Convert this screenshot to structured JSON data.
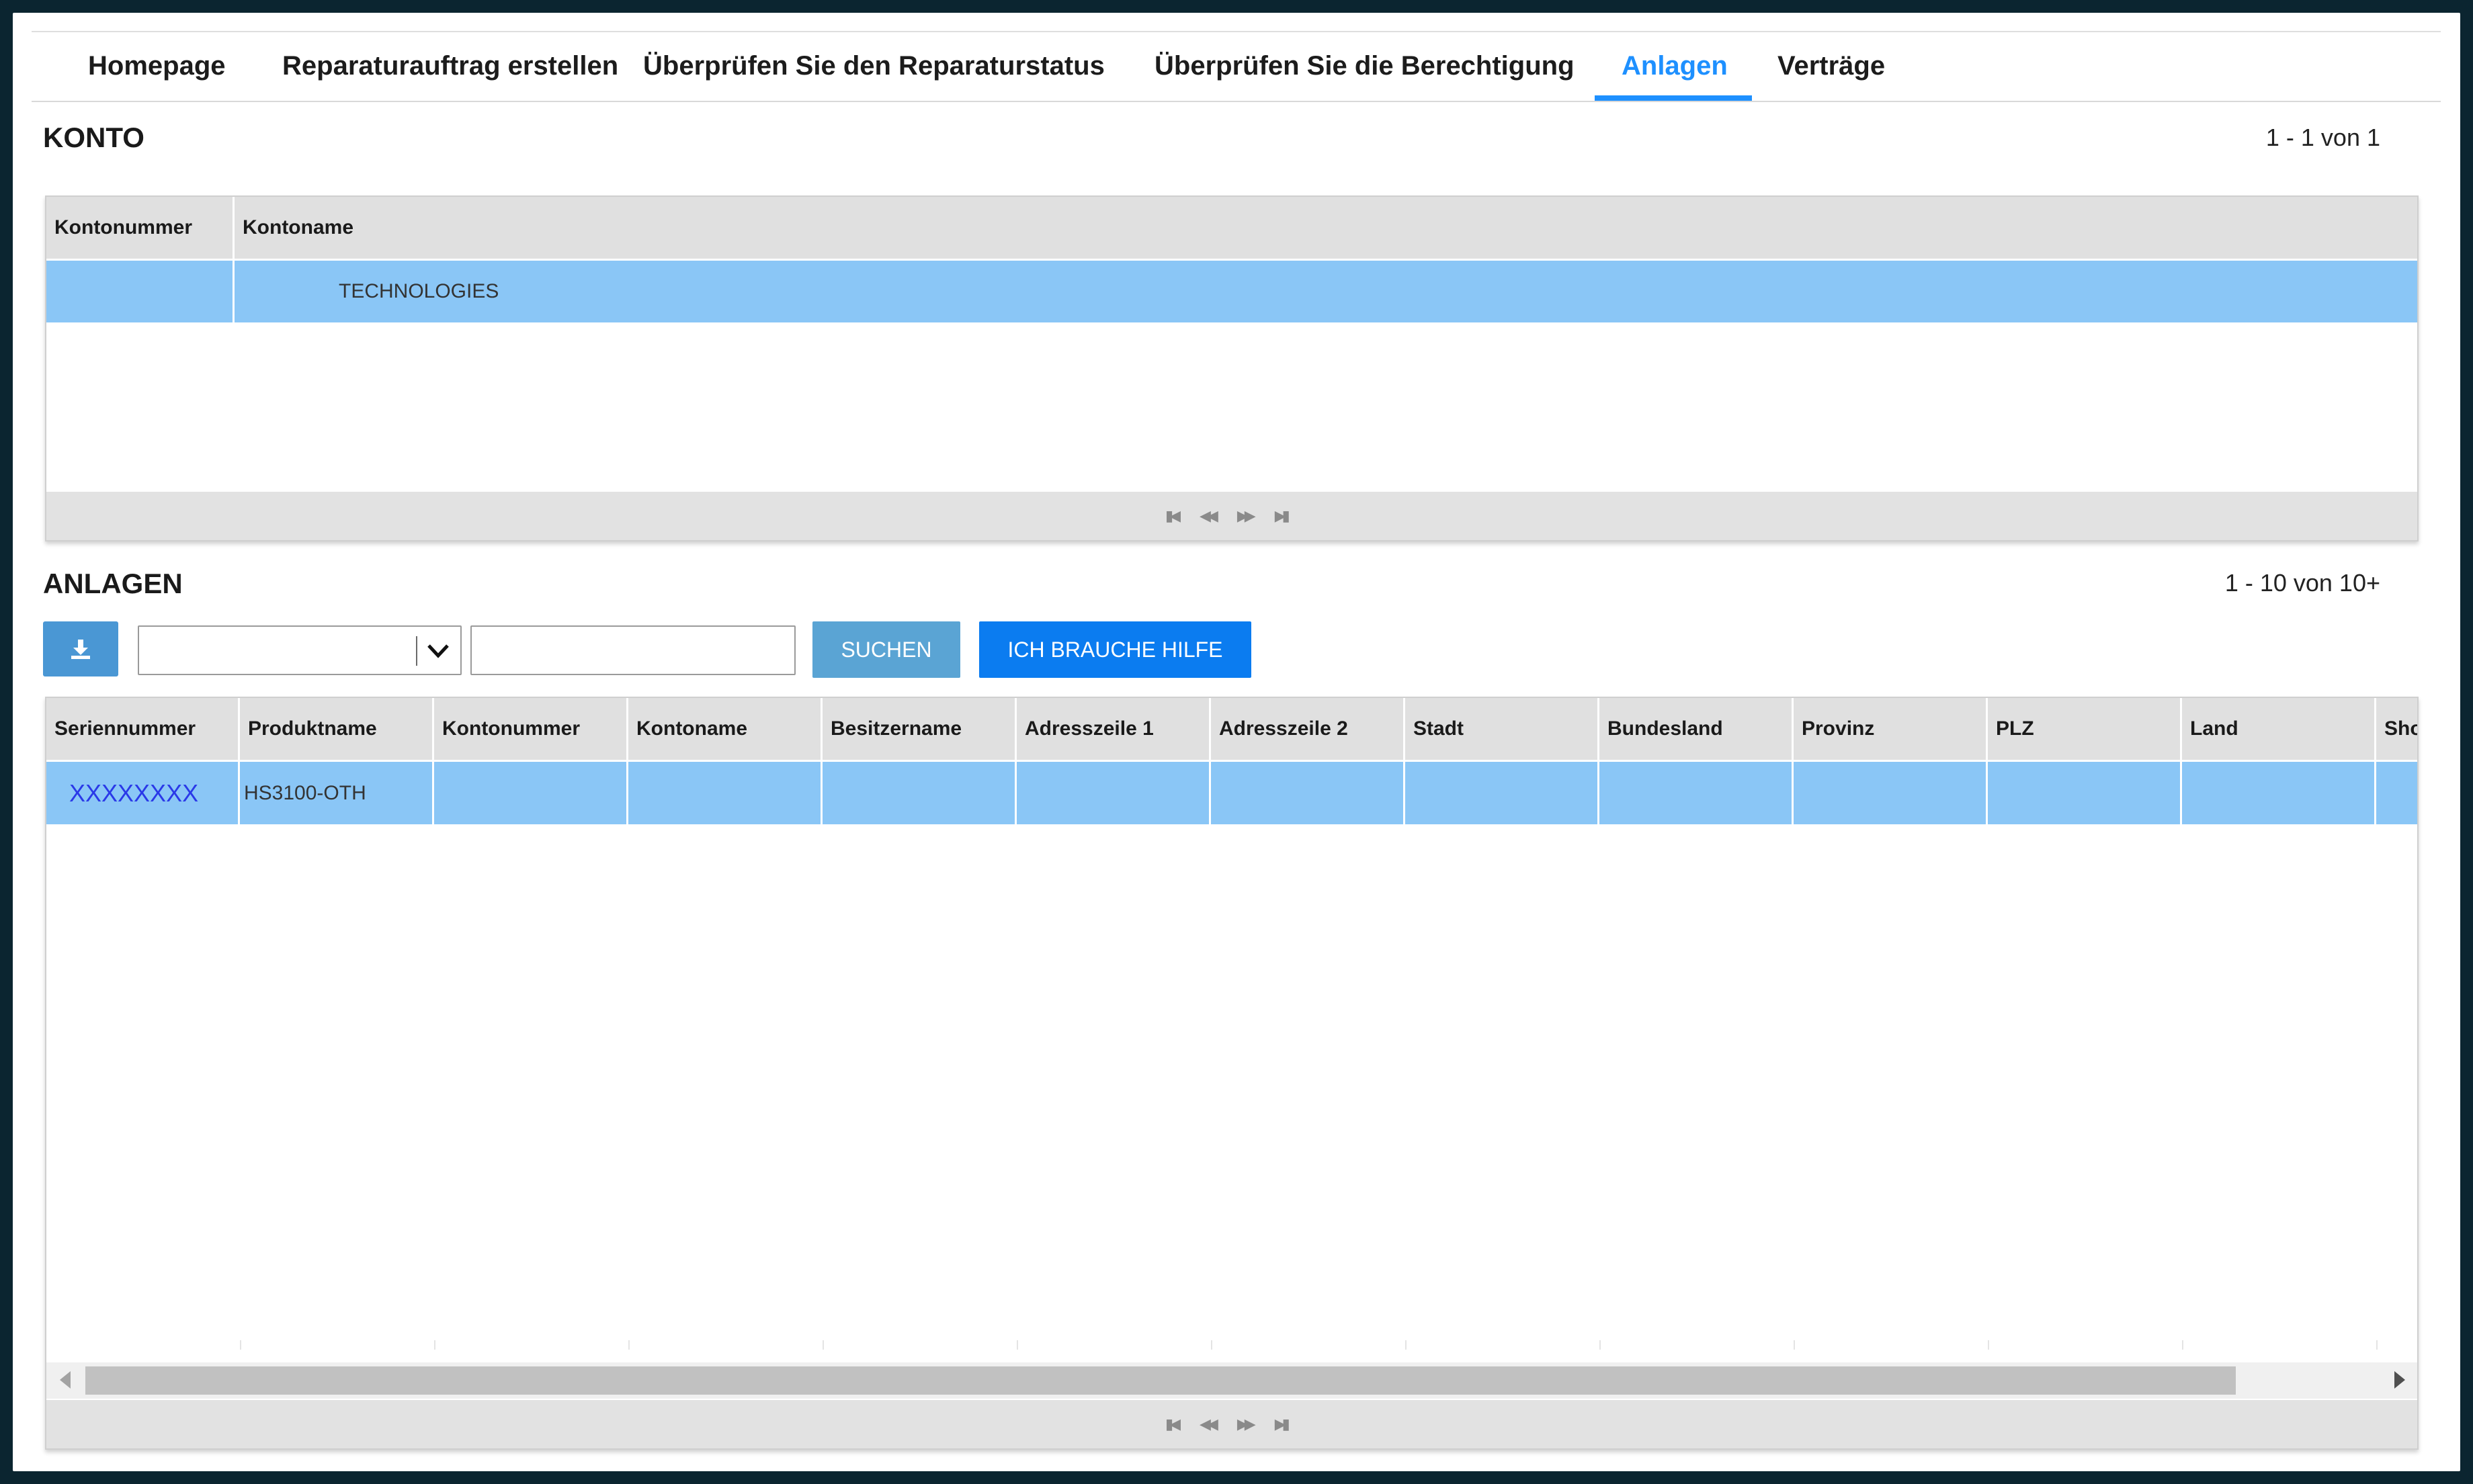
{
  "nav": {
    "tabs": [
      {
        "label": "Homepage"
      },
      {
        "label": "Reparaturauftrag erstellen"
      },
      {
        "label": "Überprüfen Sie den Reparaturstatus"
      },
      {
        "label": "Überprüfen Sie die Berechtigung"
      },
      {
        "label": "Anlagen",
        "active": true
      },
      {
        "label": "Verträge"
      }
    ]
  },
  "konto": {
    "title": "KONTO",
    "pager": "1 - 1 von 1",
    "columns": [
      "Kontonummer",
      "Kontoname"
    ],
    "rows": [
      {
        "kontonummer": "",
        "kontoname": "TECHNOLOGIES"
      }
    ]
  },
  "anlagen": {
    "title": "ANLAGEN",
    "pager": "1 - 10 von 10+",
    "search_select_value": "",
    "search_input_value": "",
    "search_button": "SUCHEN",
    "help_button": "ICH BRAUCHE HILFE",
    "columns": [
      "Seriennummer",
      "Produktname",
      "Kontonummer",
      "Kontoname",
      "Besitzername",
      "Adresszeile 1",
      "Adresszeile 2",
      "Stadt",
      "Bundesland",
      "Provinz",
      "PLZ",
      "Land",
      "Sho"
    ],
    "rows": [
      {
        "seriennummer": "XXXXXXXX",
        "produktname": "HS3100-OTH",
        "kontonummer": "",
        "kontoname": "",
        "besitzername": "",
        "adresszeile1": "",
        "adresszeile2": "",
        "stadt": "",
        "bundesland": "",
        "provinz": "",
        "plz": "",
        "land": "",
        "sho": ""
      }
    ]
  },
  "icons": {
    "download": "download-icon",
    "dropdown": "chevron-down-icon",
    "pager": [
      "first-page-icon",
      "prev-page-icon",
      "next-page-icon",
      "last-page-icon"
    ]
  },
  "colors": {
    "accent": "#1e90ff",
    "selected_row": "#8ac6f6",
    "header_bg": "#e0e0e0",
    "help_button": "#0b7cf0",
    "search_button": "#5aa4d4"
  }
}
